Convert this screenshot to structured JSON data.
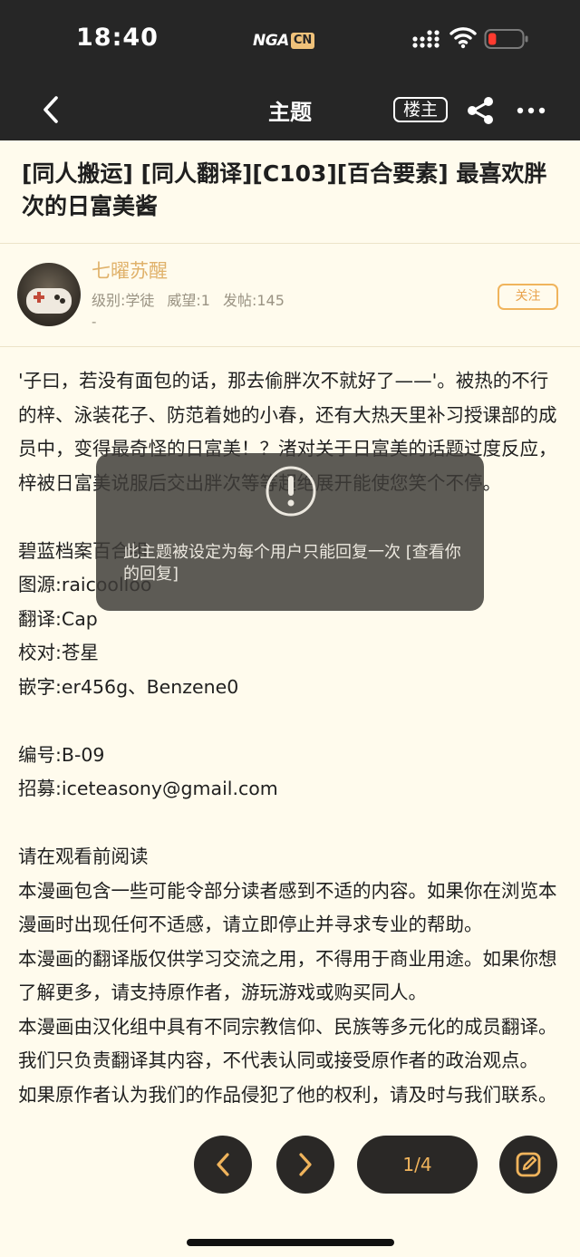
{
  "status_bar": {
    "time": "18:40",
    "carrier_main": "NGA",
    "carrier_badge": "CN",
    "icons": [
      "signal-icon",
      "wifi-icon",
      "battery-icon"
    ],
    "battery_level": 0.12,
    "battery_color": "#ff3b30"
  },
  "nav": {
    "back_icon": "chevron-left-icon",
    "title": "主题",
    "op_label": "楼主",
    "share_icon": "share-icon",
    "more_icon": "more-horizontal-icon"
  },
  "topic": {
    "title": "[同人搬运] [同人翻译][C103][百合要素] 最喜欢胖次的日富美酱"
  },
  "author": {
    "name": "七曜苏醒",
    "level": "级别:学徒",
    "prestige": "威望:1",
    "posts": "发帖:145",
    "extra": "-",
    "follow_label": "关注"
  },
  "post": {
    "intro": "'子曰，若没有面包的话，那去偷胖次不就好了——'。被热的不行的梓、泳装花子、防范着她的小春，还有大热天里补习授课部的成员中，变得最奇怪的日富美！？渚对关于日富美的话题过度反应，梓被日富美说服后交出胖次等等超绝展开能使您笑个不停。",
    "group": "碧蓝档案百合组",
    "source": "图源:raicoolloo",
    "translator": "翻译:Cap",
    "proofreader": "校对:苍星",
    "typesetter": "嵌字:er456g、Benzene0",
    "number": "编号:B-09",
    "recruit": "招募:iceteasony@gmail.com",
    "notice_title": "请在观看前阅读",
    "notice_1": "本漫画包含一些可能令部分读者感到不适的内容。如果你在浏览本漫画时出现任何不适感，请立即停止并寻求专业的帮助。",
    "notice_2": "本漫画的翻译版仅供学习交流之用，不得用于商业用途。如果你想了解更多，请支持原作者，游玩游戏或购买同人。",
    "notice_3": "本漫画由汉化组中具有不同宗教信仰、民族等多元化的成员翻译。我们只负责翻译其内容，不代表认同或接受原作者的政治观点。",
    "notice_4": "如果原作者认为我们的作品侵犯了他的权利，请及时与我们联系。"
  },
  "toast": {
    "icon": "exclamation-circle-icon",
    "message": "此主题被设定为每个用户只能回复一次 [查看你的回复]"
  },
  "bottom": {
    "prev_icon": "chevron-left-icon",
    "next_icon": "chevron-right-icon",
    "page_indicator": "1/4",
    "edit_icon": "edit-icon",
    "accent": "#f0b45c"
  }
}
